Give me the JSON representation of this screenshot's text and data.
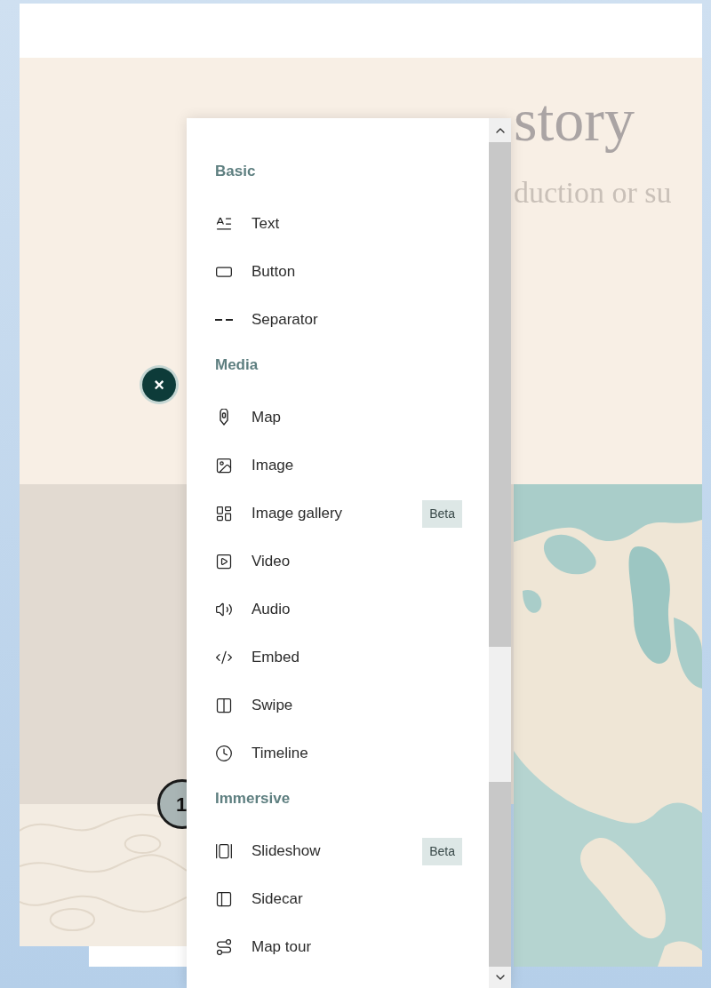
{
  "hero": {
    "title": "story",
    "subtitle": "duction or su"
  },
  "close_button": {
    "label": "×"
  },
  "step_marker": {
    "label": "1"
  },
  "menu": {
    "sections": [
      {
        "title": "Basic",
        "items": [
          {
            "label": "Text"
          },
          {
            "label": "Button"
          },
          {
            "label": "Separator"
          }
        ]
      },
      {
        "title": "Media",
        "items": [
          {
            "label": "Map"
          },
          {
            "label": "Image"
          },
          {
            "label": "Image gallery",
            "badge": "Beta"
          },
          {
            "label": "Video"
          },
          {
            "label": "Audio"
          },
          {
            "label": "Embed"
          },
          {
            "label": "Swipe"
          },
          {
            "label": "Timeline"
          }
        ]
      },
      {
        "title": "Immersive",
        "items": [
          {
            "label": "Slideshow",
            "badge": "Beta"
          },
          {
            "label": "Sidecar"
          },
          {
            "label": "Map tour"
          }
        ]
      }
    ]
  }
}
